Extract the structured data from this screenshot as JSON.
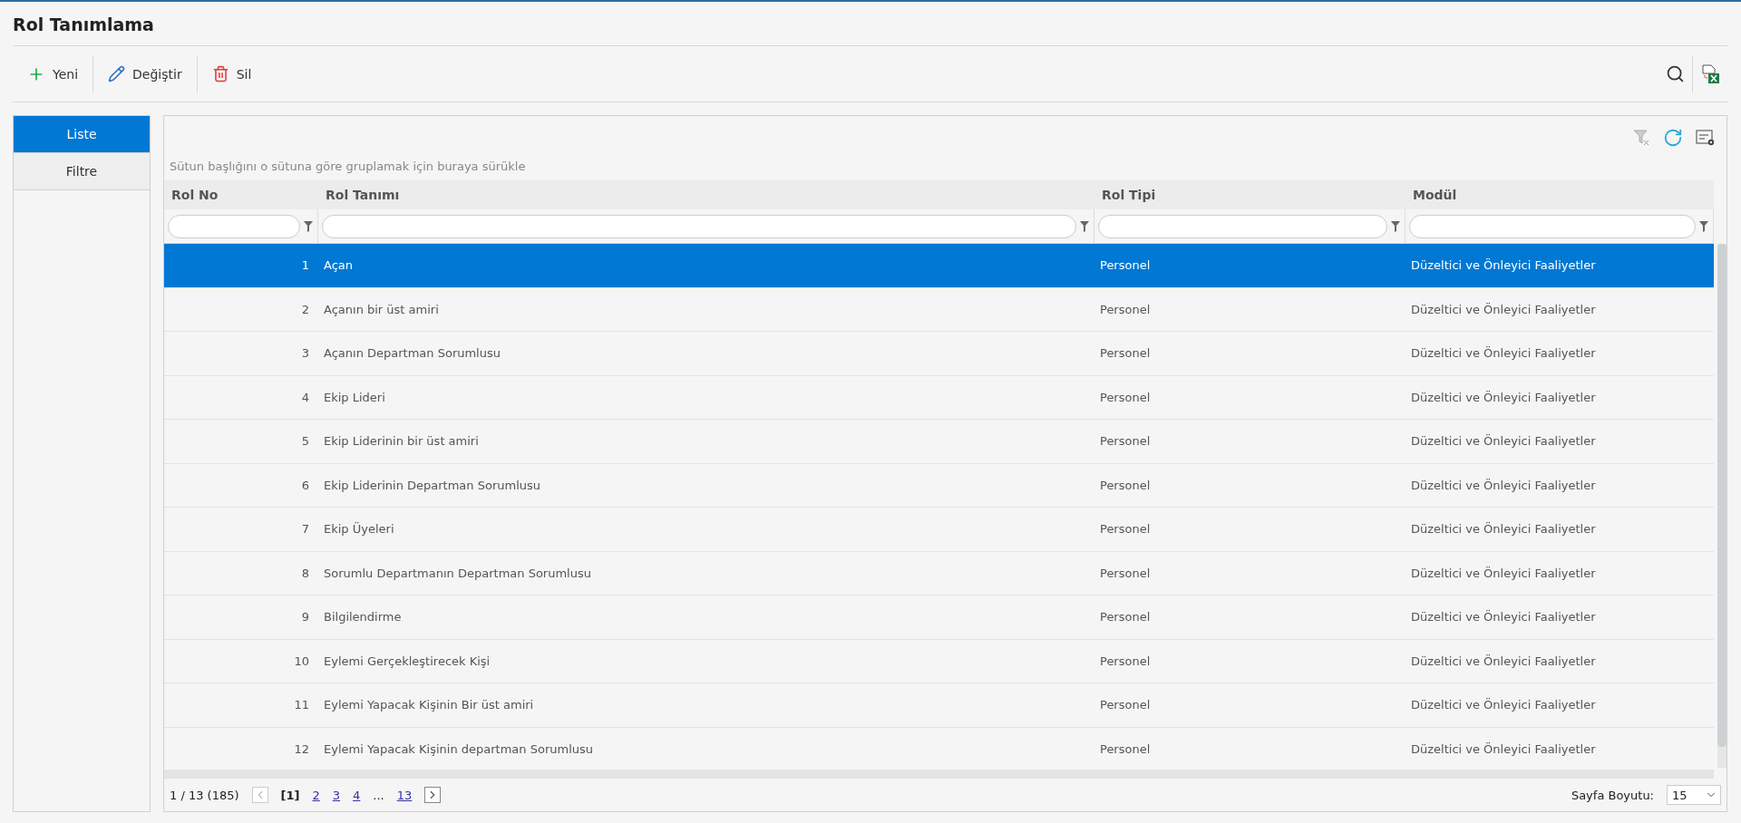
{
  "page": {
    "title": "Rol Tanımlama"
  },
  "toolbar": {
    "buttons": [
      {
        "kind": "new",
        "label": "Yeni"
      },
      {
        "kind": "edit",
        "label": "Değiştir"
      },
      {
        "kind": "delete",
        "label": "Sil"
      }
    ]
  },
  "side_tabs": [
    {
      "label": "Liste",
      "selected": true
    },
    {
      "label": "Filtre",
      "selected": false
    }
  ],
  "grid": {
    "group_hint": "Sütun başlığını o sütuna göre gruplamak için buraya sürükle",
    "columns": [
      "Rol No",
      "Rol Tanımı",
      "Rol Tipi",
      "Modül"
    ],
    "rows": [
      {
        "no": "1",
        "name": "Açan",
        "type": "Personel",
        "module": "Düzeltici ve Önleyici Faaliyetler",
        "selected": true
      },
      {
        "no": "2",
        "name": "Açanın bir üst amiri",
        "type": "Personel",
        "module": "Düzeltici ve Önleyici Faaliyetler",
        "selected": false
      },
      {
        "no": "3",
        "name": "Açanın Departman Sorumlusu",
        "type": "Personel",
        "module": "Düzeltici ve Önleyici Faaliyetler",
        "selected": false
      },
      {
        "no": "4",
        "name": "Ekip Lideri",
        "type": "Personel",
        "module": "Düzeltici ve Önleyici Faaliyetler",
        "selected": false
      },
      {
        "no": "5",
        "name": "Ekip Liderinin bir üst amiri",
        "type": "Personel",
        "module": "Düzeltici ve Önleyici Faaliyetler",
        "selected": false
      },
      {
        "no": "6",
        "name": "Ekip Liderinin Departman Sorumlusu",
        "type": "Personel",
        "module": "Düzeltici ve Önleyici Faaliyetler",
        "selected": false
      },
      {
        "no": "7",
        "name": "Ekip Üyeleri",
        "type": "Personel",
        "module": "Düzeltici ve Önleyici Faaliyetler",
        "selected": false
      },
      {
        "no": "8",
        "name": "Sorumlu Departmanın Departman Sorumlusu",
        "type": "Personel",
        "module": "Düzeltici ve Önleyici Faaliyetler",
        "selected": false
      },
      {
        "no": "9",
        "name": "Bilgilendirme",
        "type": "Personel",
        "module": "Düzeltici ve Önleyici Faaliyetler",
        "selected": false
      },
      {
        "no": "10",
        "name": "Eylemi Gerçekleştirecek Kişi",
        "type": "Personel",
        "module": "Düzeltici ve Önleyici Faaliyetler",
        "selected": false
      },
      {
        "no": "11",
        "name": "Eylemi Yapacak Kişinin Bir üst amiri",
        "type": "Personel",
        "module": "Düzeltici ve Önleyici Faaliyetler",
        "selected": false
      },
      {
        "no": "12",
        "name": "Eylemi Yapacak Kişinin departman Sorumlusu",
        "type": "Personel",
        "module": "Düzeltici ve Önleyici Faaliyetler",
        "selected": false
      }
    ],
    "pager": {
      "info": "1 / 13 (185)",
      "pages": [
        {
          "kind": "page",
          "label": "[1]",
          "selected": true
        },
        {
          "kind": "page",
          "label": "2",
          "selected": false
        },
        {
          "kind": "page",
          "label": "3",
          "selected": false
        },
        {
          "kind": "page",
          "label": "4",
          "selected": false
        },
        {
          "kind": "gap",
          "label": "...",
          "selected": false
        },
        {
          "kind": "page",
          "label": "13",
          "selected": false
        }
      ],
      "page_size_label": "Sayfa Boyutu:",
      "page_size": "15"
    }
  }
}
